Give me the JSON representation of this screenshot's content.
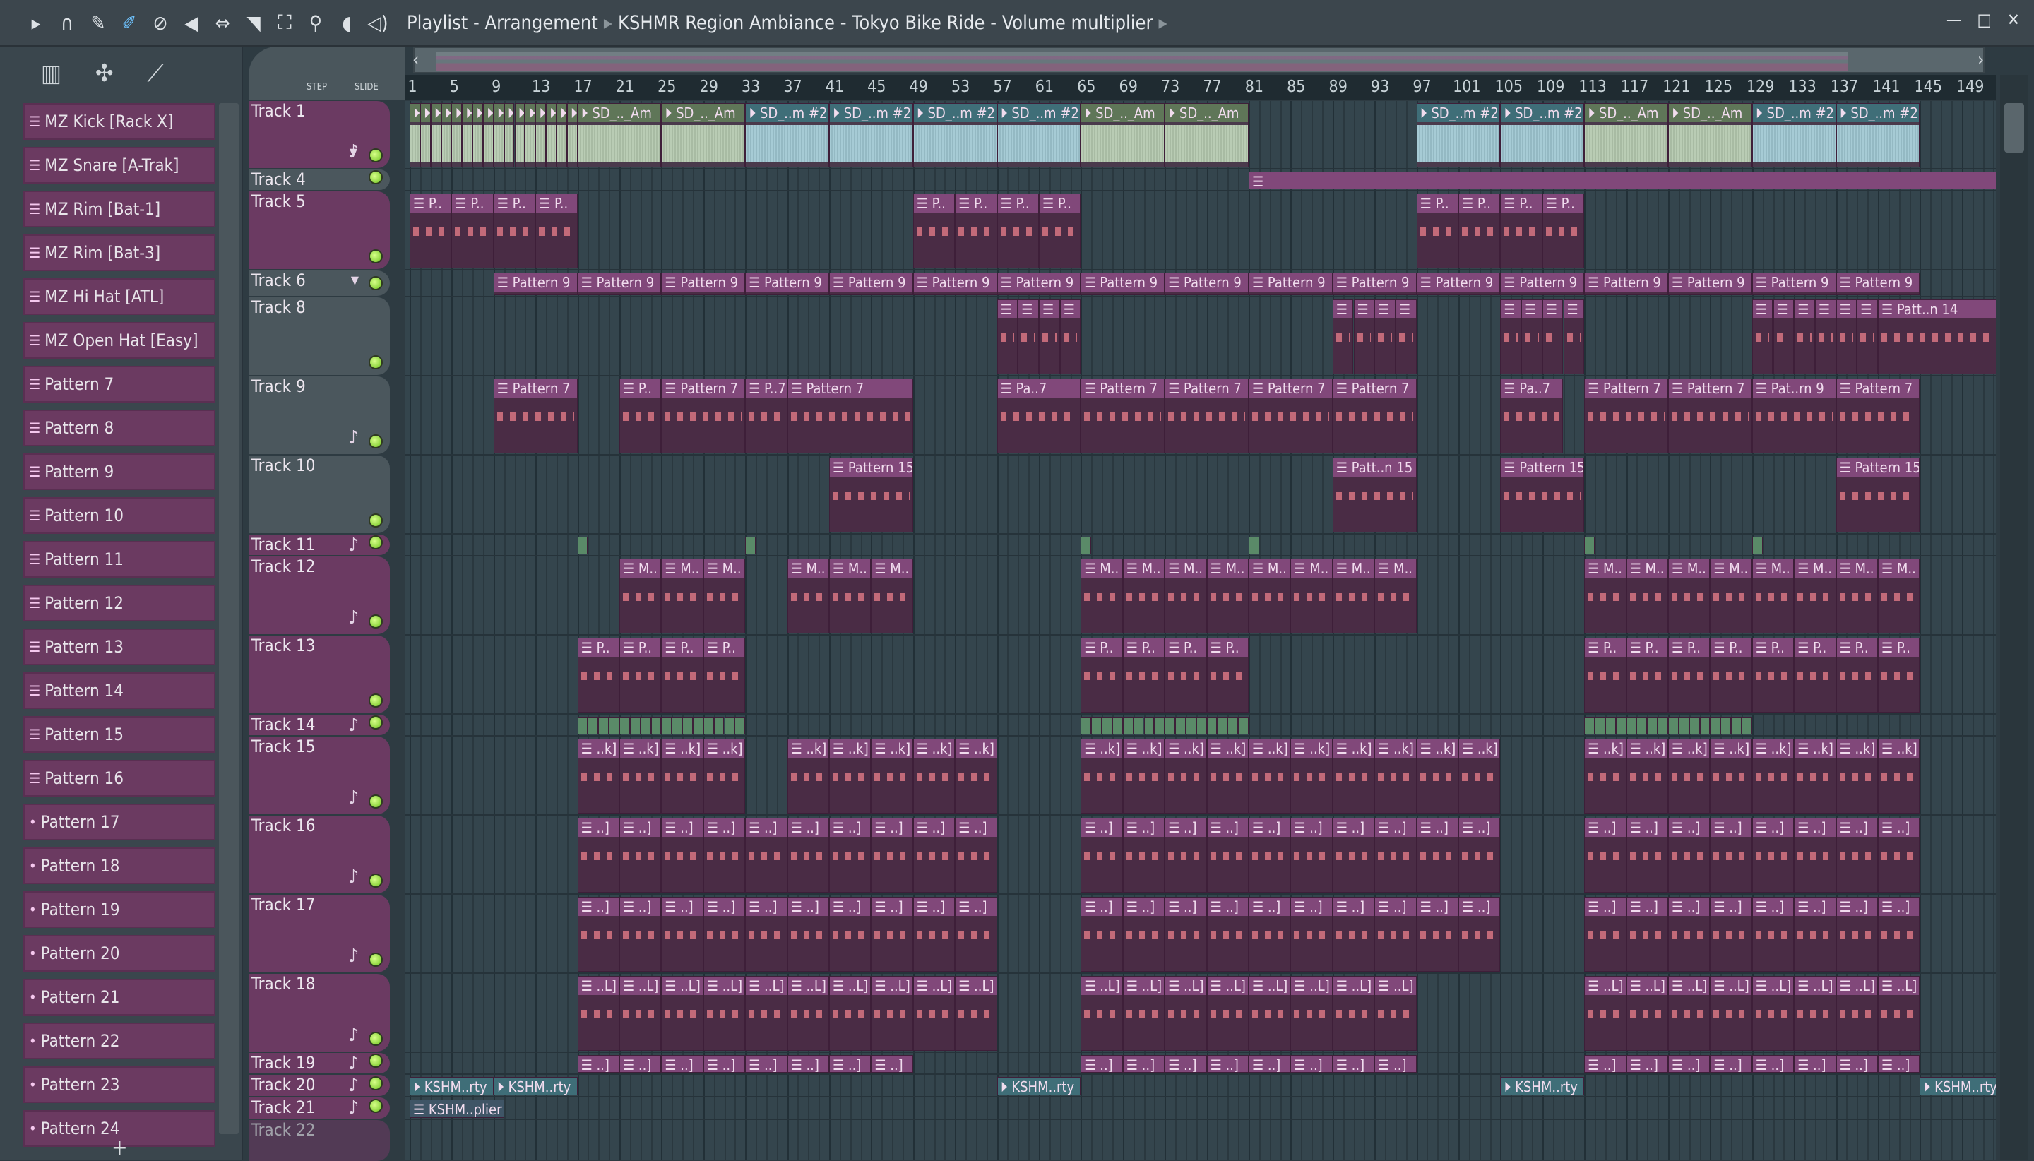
{
  "toolbar": {
    "icons": [
      "play-icon",
      "magnet-icon",
      "pencil-icon",
      "paint-icon",
      "delete-icon",
      "mute-icon",
      "slip-icon",
      "slice-icon",
      "select-icon",
      "zoom-icon",
      "playback-icon",
      "speaker-icon"
    ],
    "breadcrumb": [
      "Playlist - Arrangement",
      "KSHMR Region Ambiance - Tokyo Bike Ride - Volume multiplier"
    ]
  },
  "window": {
    "minimize": "—",
    "maximize": "□",
    "close": "✕"
  },
  "header": {
    "step_label": "STEP",
    "slide_label": "SLIDE"
  },
  "channels": [
    {
      "name": "MZ Kick [Rack X]",
      "icon": "pattern"
    },
    {
      "name": "MZ Snare [A-Trak]",
      "icon": "pattern"
    },
    {
      "name": "MZ Rim [Bat-1]",
      "icon": "pattern"
    },
    {
      "name": "MZ Rim [Bat-3]",
      "icon": "pattern"
    },
    {
      "name": "MZ Hi Hat [ATL]",
      "icon": "pattern"
    },
    {
      "name": "MZ Open Hat [Easy]",
      "icon": "pattern"
    },
    {
      "name": "Pattern 7",
      "icon": "pattern"
    },
    {
      "name": "Pattern 8",
      "icon": "pattern"
    },
    {
      "name": "Pattern 9",
      "icon": "pattern"
    },
    {
      "name": "Pattern 10",
      "icon": "pattern"
    },
    {
      "name": "Pattern 11",
      "icon": "pattern"
    },
    {
      "name": "Pattern 12",
      "icon": "pattern"
    },
    {
      "name": "Pattern 13",
      "icon": "pattern"
    },
    {
      "name": "Pattern 14",
      "icon": "pattern"
    },
    {
      "name": "Pattern 15",
      "icon": "pattern"
    },
    {
      "name": "Pattern 16",
      "icon": "pattern"
    },
    {
      "name": "Pattern 17",
      "icon": "dot"
    },
    {
      "name": "Pattern 18",
      "icon": "dot"
    },
    {
      "name": "Pattern 19",
      "icon": "dot"
    },
    {
      "name": "Pattern 20",
      "icon": "dot"
    },
    {
      "name": "Pattern 21",
      "icon": "dot"
    },
    {
      "name": "Pattern 22",
      "icon": "dot"
    },
    {
      "name": "Pattern 23",
      "icon": "dot"
    },
    {
      "name": "Pattern 24",
      "icon": "dot"
    }
  ],
  "ruler": [
    1,
    5,
    9,
    13,
    17,
    21,
    25,
    29,
    33,
    37,
    41,
    45,
    49,
    53,
    57,
    61,
    65,
    69,
    73,
    77,
    81,
    85,
    89,
    93,
    97,
    101,
    105,
    109,
    113,
    117,
    121,
    125,
    129,
    133,
    137,
    141,
    145,
    149
  ],
  "tracks": [
    {
      "name": "Track 1",
      "style": "p",
      "note": true,
      "dropdown": true,
      "clips": [
        {
          "from": 1,
          "to": 17,
          "step": 1,
          "label": "",
          "kind": "aud-g"
        },
        {
          "from": 17,
          "to": 33,
          "step": 8,
          "label": "SD_.._Am",
          "kind": "aud-g"
        },
        {
          "from": 33,
          "to": 65,
          "step": 8,
          "label": "SD_..m #2",
          "kind": "aud-b"
        },
        {
          "from": 65,
          "to": 81,
          "step": 8,
          "label": "SD_.._Am",
          "kind": "aud-g"
        },
        {
          "from": 97,
          "to": 113,
          "step": 8,
          "label": "SD_..m #2",
          "kind": "aud-b"
        },
        {
          "from": 113,
          "to": 129,
          "step": 8,
          "label": "SD_.._Am",
          "kind": "aud-g"
        },
        {
          "from": 129,
          "to": 145,
          "step": 8,
          "label": "SD_..m #2",
          "kind": "aud-b"
        }
      ]
    },
    {
      "name": "Track 4",
      "style": "g",
      "clips": [
        {
          "from": 81,
          "to": 153,
          "step": 72,
          "label": "",
          "kind": "pat"
        }
      ]
    },
    {
      "name": "Track 5",
      "style": "p",
      "clips": [
        {
          "from": 1,
          "to": 17,
          "step": 4,
          "label": "P..",
          "kind": "pat"
        },
        {
          "from": 49,
          "to": 65,
          "step": 4,
          "label": "P..",
          "kind": "pat"
        },
        {
          "from": 97,
          "to": 113,
          "step": 4,
          "label": "P..",
          "kind": "pat"
        }
      ]
    },
    {
      "name": "Track 6",
      "style": "g",
      "dropdown": true,
      "clips": [
        {
          "from": 9,
          "to": 145,
          "step": 8,
          "label": "Pattern 9",
          "kind": "pat"
        }
      ]
    },
    {
      "name": "Track 8",
      "style": "g",
      "clips": [
        {
          "from": 57,
          "to": 65,
          "step": 2,
          "label": "",
          "kind": "pat"
        },
        {
          "from": 89,
          "to": 97,
          "step": 2,
          "label": "",
          "kind": "pat"
        },
        {
          "from": 105,
          "to": 113,
          "step": 2,
          "label": "",
          "kind": "pat"
        },
        {
          "from": 129,
          "to": 141,
          "step": 2,
          "label": "",
          "kind": "pat"
        },
        {
          "from": 141,
          "to": 153,
          "step": 12,
          "label": "Patt..n 14",
          "kind": "pat"
        }
      ]
    },
    {
      "name": "Track 9",
      "style": "g",
      "note": true,
      "clips": [
        {
          "from": 9,
          "to": 17,
          "step": 8,
          "label": "Pattern 7",
          "kind": "pat"
        },
        {
          "from": 21,
          "to": 25,
          "step": 4,
          "label": "P..",
          "kind": "pat"
        },
        {
          "from": 25,
          "to": 33,
          "step": 8,
          "label": "Pattern 7",
          "kind": "pat"
        },
        {
          "from": 33,
          "to": 37,
          "step": 4,
          "label": "P..7",
          "kind": "pat"
        },
        {
          "from": 37,
          "to": 49,
          "step": 12,
          "label": "Pattern 7",
          "kind": "pat"
        },
        {
          "from": 57,
          "to": 65,
          "step": 8,
          "label": "Pa..7",
          "kind": "pat"
        },
        {
          "from": 65,
          "to": 97,
          "step": 8,
          "label": "Pattern 7",
          "kind": "pat"
        },
        {
          "from": 105,
          "to": 111,
          "step": 6,
          "label": "Pa..7",
          "kind": "pat"
        },
        {
          "from": 113,
          "to": 129,
          "step": 8,
          "label": "Pattern 7",
          "kind": "pat"
        },
        {
          "from": 129,
          "to": 137,
          "step": 8,
          "label": "Pat..rn 9",
          "kind": "pat"
        },
        {
          "from": 137,
          "to": 145,
          "step": 8,
          "label": "Pattern 7",
          "kind": "pat"
        }
      ]
    },
    {
      "name": "Track 10",
      "style": "g",
      "clips": [
        {
          "from": 41,
          "to": 49,
          "step": 8,
          "label": "Pattern 15",
          "kind": "pat"
        },
        {
          "from": 89,
          "to": 97,
          "step": 8,
          "label": "Patt..n 15",
          "kind": "pat"
        },
        {
          "from": 105,
          "to": 113,
          "step": 8,
          "label": "Pattern 15",
          "kind": "pat"
        },
        {
          "from": 137,
          "to": 145,
          "step": 8,
          "label": "Pattern 15",
          "kind": "pat"
        }
      ]
    },
    {
      "name": "Track 11",
      "style": "p",
      "note": true,
      "clips": [
        {
          "from": 17,
          "to": 18,
          "step": 1,
          "label": "",
          "kind": "grn"
        },
        {
          "from": 33,
          "to": 34,
          "step": 1,
          "label": "",
          "kind": "grn"
        },
        {
          "from": 65,
          "to": 66,
          "step": 1,
          "label": "",
          "kind": "grn"
        },
        {
          "from": 81,
          "to": 82,
          "step": 1,
          "label": "",
          "kind": "grn"
        },
        {
          "from": 113,
          "to": 114,
          "step": 1,
          "label": "",
          "kind": "grn"
        },
        {
          "from": 129,
          "to": 130,
          "step": 1,
          "label": "",
          "kind": "grn"
        }
      ]
    },
    {
      "name": "Track 12",
      "style": "p",
      "note": true,
      "clips": [
        {
          "from": 21,
          "to": 33,
          "step": 4,
          "label": "M..",
          "kind": "pat"
        },
        {
          "from": 37,
          "to": 49,
          "step": 4,
          "label": "M..",
          "kind": "pat"
        },
        {
          "from": 65,
          "to": 97,
          "step": 4,
          "label": "M..",
          "kind": "pat"
        },
        {
          "from": 113,
          "to": 145,
          "step": 4,
          "label": "M..",
          "kind": "pat"
        }
      ]
    },
    {
      "name": "Track 13",
      "style": "p",
      "clips": [
        {
          "from": 17,
          "to": 33,
          "step": 4,
          "label": "P..",
          "kind": "pat"
        },
        {
          "from": 65,
          "to": 81,
          "step": 4,
          "label": "P..",
          "kind": "pat"
        },
        {
          "from": 113,
          "to": 145,
          "step": 4,
          "label": "P..",
          "kind": "pat"
        }
      ]
    },
    {
      "name": "Track 14",
      "style": "p",
      "note": true,
      "clips": [
        {
          "from": 17,
          "to": 33,
          "step": 1,
          "label": "",
          "kind": "grn"
        },
        {
          "from": 65,
          "to": 81,
          "step": 1,
          "label": "",
          "kind": "grn"
        },
        {
          "from": 113,
          "to": 129,
          "step": 1,
          "label": "",
          "kind": "grn"
        }
      ]
    },
    {
      "name": "Track 15",
      "style": "p",
      "note": true,
      "clips": [
        {
          "from": 17,
          "to": 33,
          "step": 4,
          "label": "..k]",
          "kind": "pat"
        },
        {
          "from": 37,
          "to": 57,
          "step": 4,
          "label": "..k]",
          "kind": "pat"
        },
        {
          "from": 65,
          "to": 105,
          "step": 4,
          "label": "..k]",
          "kind": "pat"
        },
        {
          "from": 113,
          "to": 145,
          "step": 4,
          "label": "..k]",
          "kind": "pat"
        }
      ]
    },
    {
      "name": "Track 16",
      "style": "p",
      "note": true,
      "clips": [
        {
          "from": 17,
          "to": 57,
          "step": 4,
          "label": "..]",
          "kind": "pat"
        },
        {
          "from": 65,
          "to": 105,
          "step": 4,
          "label": "..]",
          "kind": "pat"
        },
        {
          "from": 113,
          "to": 145,
          "step": 4,
          "label": "..]",
          "kind": "pat"
        }
      ]
    },
    {
      "name": "Track 17",
      "style": "p",
      "note": true,
      "clips": [
        {
          "from": 17,
          "to": 57,
          "step": 4,
          "label": "..]",
          "kind": "pat"
        },
        {
          "from": 65,
          "to": 105,
          "step": 4,
          "label": "..]",
          "kind": "pat"
        },
        {
          "from": 113,
          "to": 145,
          "step": 4,
          "label": "..]",
          "kind": "pat"
        }
      ]
    },
    {
      "name": "Track 18",
      "style": "p",
      "note": true,
      "clips": [
        {
          "from": 17,
          "to": 57,
          "step": 4,
          "label": "..L]",
          "kind": "pat"
        },
        {
          "from": 65,
          "to": 97,
          "step": 4,
          "label": "..L]",
          "kind": "pat"
        },
        {
          "from": 113,
          "to": 145,
          "step": 4,
          "label": "..L]",
          "kind": "pat"
        }
      ]
    },
    {
      "name": "Track 19",
      "style": "p",
      "note": true,
      "clips": [
        {
          "from": 17,
          "to": 49,
          "step": 4,
          "label": "..]",
          "kind": "pat"
        },
        {
          "from": 65,
          "to": 97,
          "step": 4,
          "label": "..]",
          "kind": "pat"
        },
        {
          "from": 113,
          "to": 145,
          "step": 4,
          "label": "..]",
          "kind": "pat"
        }
      ]
    },
    {
      "name": "Track 20",
      "style": "p",
      "note": true,
      "clips": [
        {
          "from": 1,
          "to": 17,
          "step": 8,
          "label": "KSHM..rty",
          "kind": "aud-b"
        },
        {
          "from": 57,
          "to": 65,
          "step": 8,
          "label": "KSHM..rty",
          "kind": "aud-b"
        },
        {
          "from": 105,
          "to": 113,
          "step": 8,
          "label": "KSHM..rty",
          "kind": "aud-b"
        },
        {
          "from": 145,
          "to": 153,
          "step": 8,
          "label": "KSHM..rty",
          "kind": "aud-b"
        }
      ]
    },
    {
      "name": "Track 21",
      "style": "p",
      "note": true,
      "clips": [
        {
          "from": 1,
          "to": 10,
          "step": 9,
          "label": "KSHM..plier",
          "kind": "aut"
        }
      ]
    },
    {
      "name": "Track 22",
      "style": "p",
      "clips": []
    }
  ]
}
